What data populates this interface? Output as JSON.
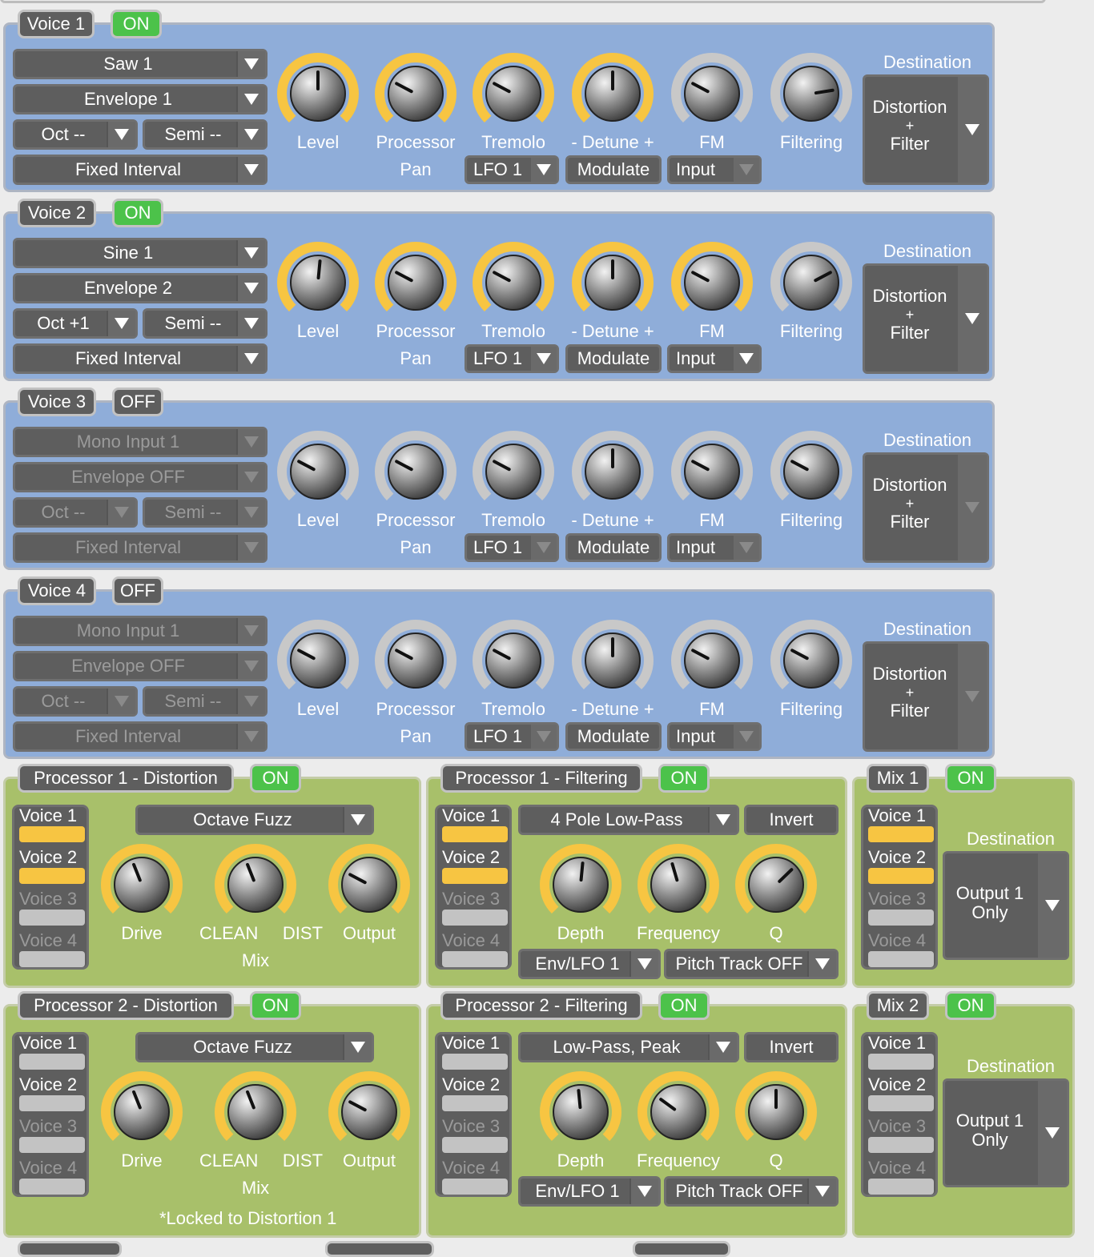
{
  "voices": [
    {
      "title": "Voice 1",
      "state": "ON",
      "active": true,
      "wave": "Saw 1",
      "env": "Envelope 1",
      "oct": "Oct --",
      "semi": "Semi --",
      "interval": "Fixed Interval",
      "lfo": "LFO 1",
      "modulate": "Modulate",
      "input": "Input",
      "input_active": false,
      "dest_label": "Destination",
      "dest": [
        "Distortion",
        "+",
        "Filter"
      ],
      "knobs": [
        {
          "label": "Level",
          "sub": "",
          "value": 0.5,
          "active": true
        },
        {
          "label": "Processor",
          "sub": "Pan",
          "value": 0.27,
          "active": true
        },
        {
          "label": "Tremolo",
          "sub": "",
          "value": 0.27,
          "active": true
        },
        {
          "label": "- Detune +",
          "sub": "",
          "value": 0.5,
          "active": true
        },
        {
          "label": "FM",
          "sub": "",
          "value": 0.27,
          "active": false
        },
        {
          "label": "Filtering",
          "sub": "",
          "value": 0.8,
          "active": false
        }
      ]
    },
    {
      "title": "Voice 2",
      "state": "ON",
      "active": true,
      "wave": "Sine 1",
      "env": "Envelope 2",
      "oct": "Oct +1",
      "semi": "Semi --",
      "interval": "Fixed Interval",
      "lfo": "LFO 1",
      "modulate": "Modulate",
      "input": "Input",
      "input_active": true,
      "dest_label": "Destination",
      "dest": [
        "Distortion",
        "+",
        "Filter"
      ],
      "knobs": [
        {
          "label": "Level",
          "sub": "",
          "value": 0.52,
          "active": true
        },
        {
          "label": "Processor",
          "sub": "Pan",
          "value": 0.27,
          "active": true
        },
        {
          "label": "Tremolo",
          "sub": "",
          "value": 0.27,
          "active": true
        },
        {
          "label": "- Detune +",
          "sub": "",
          "value": 0.5,
          "active": true
        },
        {
          "label": "FM",
          "sub": "",
          "value": 0.27,
          "active": true
        },
        {
          "label": "Filtering",
          "sub": "",
          "value": 0.73,
          "active": false
        }
      ]
    },
    {
      "title": "Voice 3",
      "state": "OFF",
      "active": false,
      "wave": "Mono Input 1",
      "env": "Envelope OFF",
      "oct": "Oct --",
      "semi": "Semi --",
      "interval": "Fixed Interval",
      "lfo": "LFO 1",
      "modulate": "Modulate",
      "input": "Input",
      "input_active": false,
      "dest_label": "Destination",
      "dest": [
        "Distortion",
        "+",
        "Filter"
      ],
      "knobs": [
        {
          "label": "Level",
          "sub": "",
          "value": 0.27,
          "active": false
        },
        {
          "label": "Processor",
          "sub": "Pan",
          "value": 0.27,
          "active": false
        },
        {
          "label": "Tremolo",
          "sub": "",
          "value": 0.27,
          "active": false
        },
        {
          "label": "- Detune +",
          "sub": "",
          "value": 0.5,
          "active": false
        },
        {
          "label": "FM",
          "sub": "",
          "value": 0.27,
          "active": false
        },
        {
          "label": "Filtering",
          "sub": "",
          "value": 0.27,
          "active": false
        }
      ]
    },
    {
      "title": "Voice 4",
      "state": "OFF",
      "active": false,
      "wave": "Mono Input 1",
      "env": "Envelope OFF",
      "oct": "Oct --",
      "semi": "Semi --",
      "interval": "Fixed Interval",
      "lfo": "LFO 1",
      "modulate": "Modulate",
      "input": "Input",
      "input_active": false,
      "dest_label": "Destination",
      "dest": [
        "Distortion",
        "+",
        "Filter"
      ],
      "knobs": [
        {
          "label": "Level",
          "sub": "",
          "value": 0.27,
          "active": false
        },
        {
          "label": "Processor",
          "sub": "Pan",
          "value": 0.27,
          "active": false
        },
        {
          "label": "Tremolo",
          "sub": "",
          "value": 0.27,
          "active": false
        },
        {
          "label": "- Detune +",
          "sub": "",
          "value": 0.5,
          "active": false
        },
        {
          "label": "FM",
          "sub": "",
          "value": 0.27,
          "active": false
        },
        {
          "label": "Filtering",
          "sub": "",
          "value": 0.27,
          "active": false
        }
      ]
    }
  ],
  "voice_labels": [
    "Voice 1",
    "Voice 2",
    "Voice 3",
    "Voice 4"
  ],
  "processors": [
    {
      "title": "Processor 1 - Distortion",
      "state": "ON",
      "mode": "Octave Fuzz",
      "voices_on": [
        true,
        true,
        false,
        false
      ],
      "knobs": [
        {
          "label": "Drive",
          "value": 0.42
        },
        {
          "label": "CLEAN     DIST",
          "value": 0.42
        },
        {
          "label": "Output",
          "value": 0.27
        }
      ],
      "mix_label": "Mix",
      "note": ""
    },
    {
      "title": "Processor 1 - Filtering",
      "state": "ON",
      "mode": "4 Pole Low-Pass",
      "invert": "Invert",
      "mod": "Env/LFO 1",
      "pitch": "Pitch Track OFF",
      "voices_on": [
        true,
        true,
        false,
        false
      ],
      "knobs": [
        {
          "label": "Depth",
          "value": 0.52
        },
        {
          "label": "Frequency",
          "value": 0.44
        },
        {
          "label": "Q",
          "value": 0.67
        }
      ]
    },
    {
      "title": "Mix 1",
      "state": "ON",
      "voices_on": [
        true,
        true,
        false,
        false
      ],
      "dest_label": "Destination",
      "dest": [
        "Output 1",
        "Only"
      ]
    },
    {
      "title": "Processor 2 - Distortion",
      "state": "ON",
      "mode": "Octave Fuzz",
      "voices_on": [
        false,
        false,
        false,
        false
      ],
      "knobs": [
        {
          "label": "Drive",
          "value": 0.42
        },
        {
          "label": "CLEAN     DIST",
          "value": 0.42
        },
        {
          "label": "Output",
          "value": 0.27
        }
      ],
      "mix_label": "Mix",
      "note": "*Locked to Distortion 1"
    },
    {
      "title": "Processor 2 - Filtering",
      "state": "ON",
      "mode": "Low-Pass, Peak",
      "invert": "Invert",
      "mod": "Env/LFO 1",
      "pitch": "Pitch Track OFF",
      "voices_on": [
        false,
        false,
        false,
        false
      ],
      "knobs": [
        {
          "label": "Depth",
          "value": 0.48
        },
        {
          "label": "Frequency",
          "value": 0.3
        },
        {
          "label": "Q",
          "value": 0.5
        }
      ]
    },
    {
      "title": "Mix 2",
      "state": "ON",
      "voices_on": [
        false,
        false,
        false,
        false
      ],
      "dest_label": "Destination",
      "dest": [
        "Output 1",
        "Only"
      ]
    }
  ],
  "colors": {
    "voice_bg": "#8fadd9",
    "proc_bg": "#a8c06a",
    "knob_active": "#f7c542",
    "knob_inactive": "#c8c8c8",
    "on_green": "#4cc24a"
  }
}
